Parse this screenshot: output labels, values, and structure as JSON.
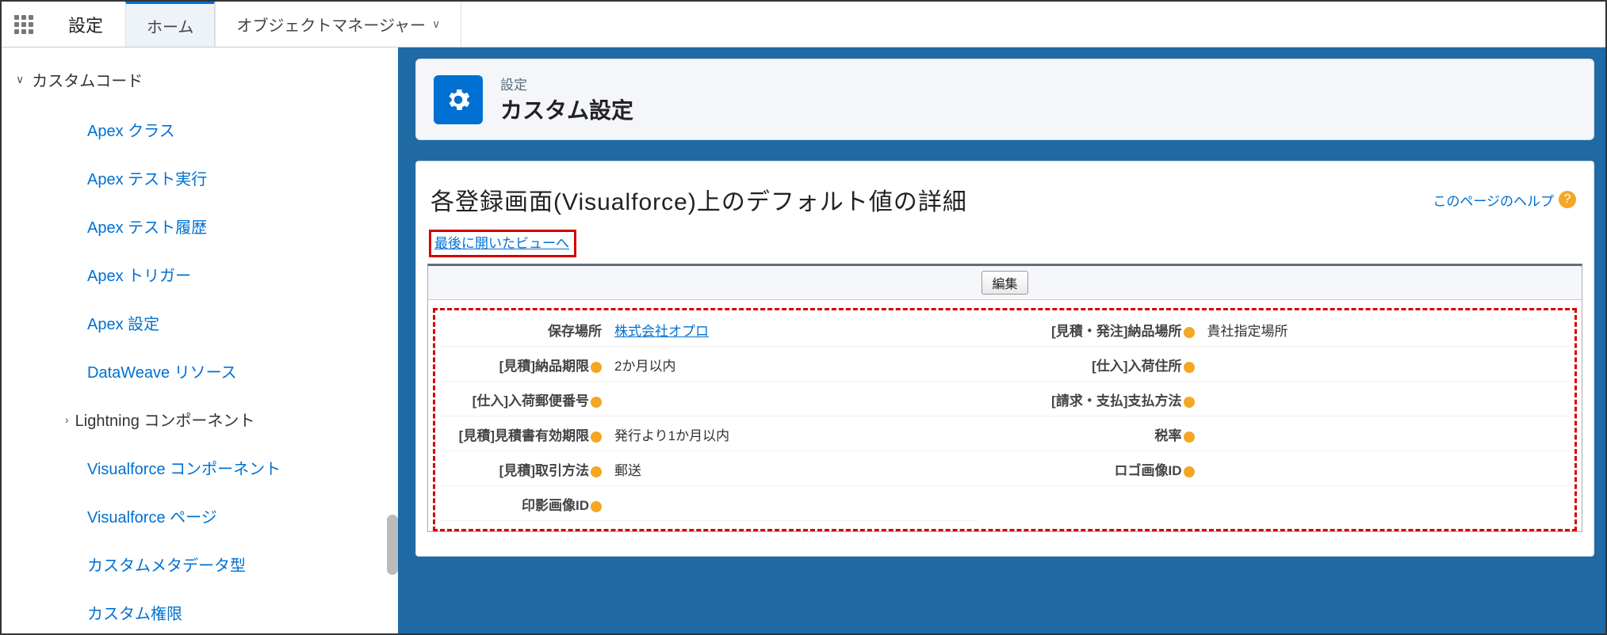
{
  "topbar": {
    "setup_label": "設定",
    "tab_home": "ホーム",
    "tab_object_manager": "オブジェクトマネージャー"
  },
  "sidebar": {
    "parent": "カスタムコード",
    "items": [
      "Apex クラス",
      "Apex テスト実行",
      "Apex テスト履歴",
      "Apex トリガー",
      "Apex 設定",
      "DataWeave リソース"
    ],
    "sub_parent": "Lightning コンポーネント",
    "items2": [
      "Visualforce コンポーネント",
      "Visualforce ページ",
      "カスタムメタデータ型",
      "カスタム権限"
    ]
  },
  "header": {
    "small": "設定",
    "big": "カスタム設定"
  },
  "page": {
    "title": "各登録画面(Visualforce)上のデフォルト値の詳細",
    "help": "このページのヘルプ",
    "back_link": "最後に開いたビューへ",
    "edit_button": "編集"
  },
  "fields": {
    "r1l": "保存場所",
    "r1v": "株式会社オプロ",
    "r1l2": "[見積・発注]納品場所",
    "r1v2": "貴社指定場所",
    "r2l": "[見積]納品期限",
    "r2v": "2か月以内",
    "r2l2": "[仕入]入荷住所",
    "r2v2": "",
    "r3l": "[仕入]入荷郵便番号",
    "r3v": "",
    "r3l2": "[請求・支払]支払方法",
    "r3v2": "",
    "r4l": "[見積]見積書有効期限",
    "r4v": "発行より1か月以内",
    "r4l2": "税率",
    "r4v2": "",
    "r5l": "[見積]取引方法",
    "r5v": "郵送",
    "r5l2": "ロゴ画像ID",
    "r5v2": "",
    "r6l": "印影画像ID",
    "r6v": "",
    "r6l2": "",
    "r6v2": ""
  }
}
